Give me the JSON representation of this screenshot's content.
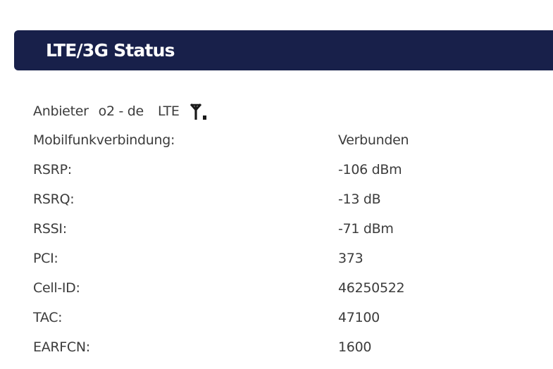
{
  "header": {
    "title": "LTE/3G Status"
  },
  "provider": {
    "label": "Anbieter",
    "name": "o2 - de",
    "network_type": "LTE",
    "icon": "antenna-signal-icon"
  },
  "status_rows": [
    {
      "label": "Mobilfunkverbindung:",
      "value": "Verbunden"
    },
    {
      "label": "RSRP:",
      "value": "-106 dBm"
    },
    {
      "label": "RSRQ:",
      "value": "-13 dB"
    },
    {
      "label": "RSSI:",
      "value": "-71 dBm"
    },
    {
      "label": "PCI:",
      "value": "373"
    },
    {
      "label": "Cell-ID:",
      "value": "46250522"
    },
    {
      "label": "TAC:",
      "value": "47100"
    },
    {
      "label": "EARFCN:",
      "value": "1600"
    }
  ],
  "colors": {
    "header_background": "#18204a",
    "header_text": "#ffffff",
    "body_text": "#3c3c3c"
  }
}
